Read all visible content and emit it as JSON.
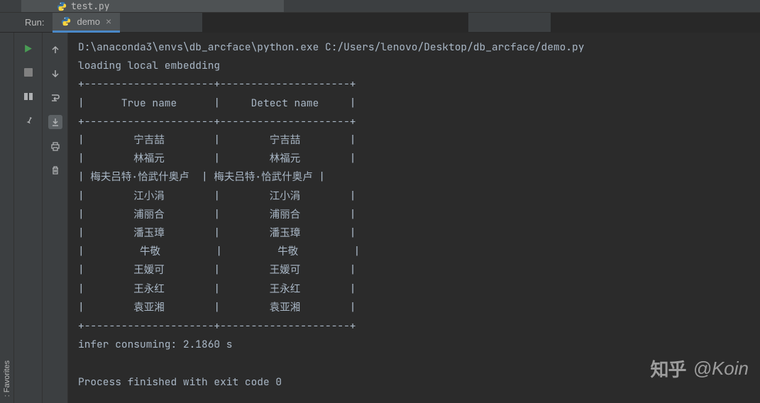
{
  "project_file": "test.py",
  "run_panel": {
    "label": "Run:",
    "tab_name": "demo"
  },
  "sidebar_tab": ": Favorites",
  "console": {
    "command": "D:\\anaconda3\\envs\\db_arcface\\python.exe C:/Users/lenovo/Desktop/db_arcface/demo.py",
    "loading_msg": "loading local embedding",
    "table_border_top": "+---------------------+---------------------+",
    "table_header": "|      True name      |     Detect name     |",
    "table_border_mid": "+---------------------+---------------------+",
    "rows": [
      "|        宁吉喆        |        宁吉喆        |",
      "|        林福元        |        林福元        |",
      "| 梅夫吕特·恰武什奥卢  | 梅夫吕特·恰武什奥卢 |",
      "|        江小涓        |        江小涓        |",
      "|        浦丽合        |        浦丽合        |",
      "|        潘玉璋        |        潘玉璋        |",
      "|         牛敬         |         牛敬         |",
      "|        王媛可        |        王媛可        |",
      "|        王永红        |        王永红        |",
      "|        袁亚湘        |        袁亚湘        |"
    ],
    "table_border_bot": "+---------------------+---------------------+",
    "infer_msg": "infer consuming: 2.1860 s",
    "exit_msg": "Process finished with exit code 0"
  },
  "watermark": {
    "logo": "知乎",
    "author": "@Koin"
  }
}
